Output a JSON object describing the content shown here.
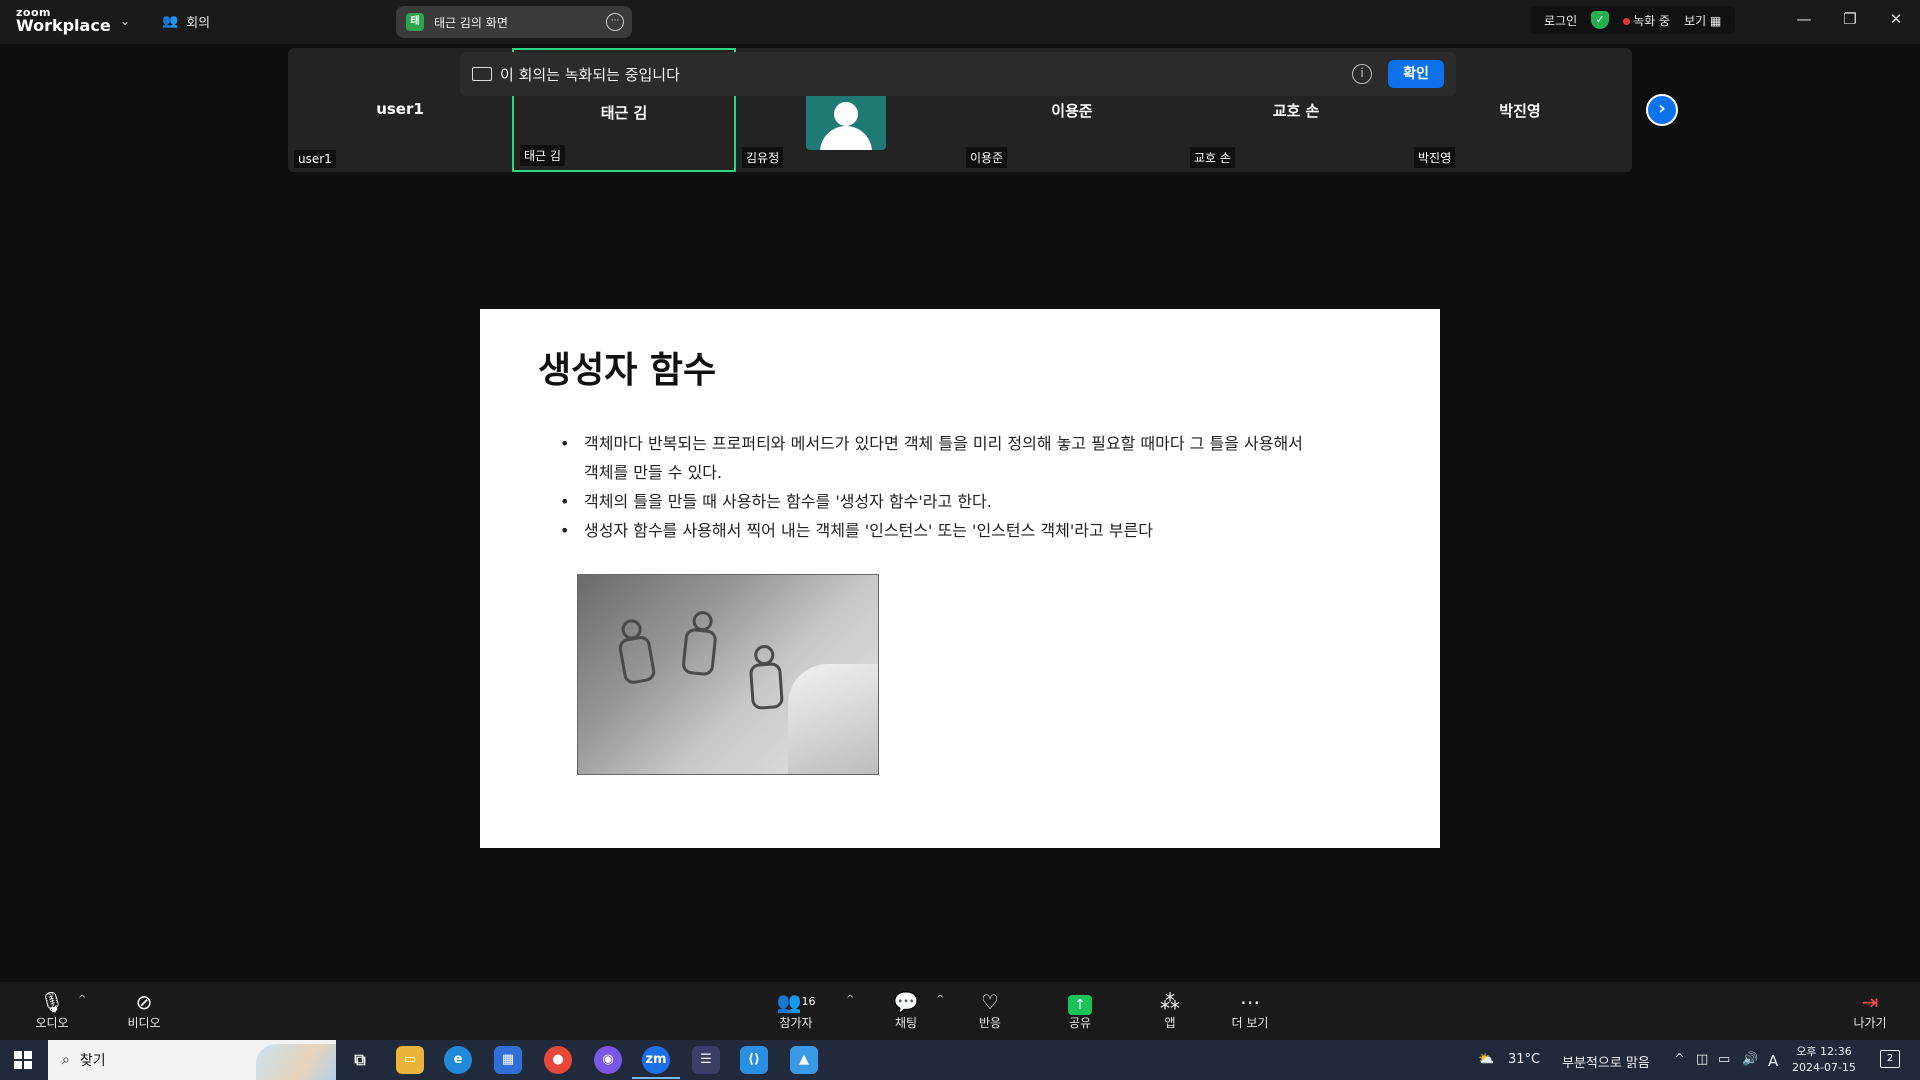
{
  "app": {
    "logo_top": "zoom",
    "logo_bottom": "Workplace",
    "meeting_label": "회의"
  },
  "share": {
    "tag": "태",
    "label": "태근 김의 화면",
    "more": "···"
  },
  "header_right": {
    "login": "로그인",
    "recording": "녹화 중",
    "view": "보기"
  },
  "participants": [
    {
      "name": "user1",
      "label": "user1"
    },
    {
      "name": "태근 김",
      "label": "태근 김"
    },
    {
      "name": "",
      "label": "김유정"
    },
    {
      "name": "이용준",
      "label": "이용준"
    },
    {
      "name": "교호 손",
      "label": "교호 손"
    },
    {
      "name": "박진영",
      "label": "박진영"
    }
  ],
  "banner": {
    "text": "이 회의는 녹화되는 중입니다",
    "info": "i",
    "confirm": "확인"
  },
  "slide": {
    "title": "생성자 함수",
    "bullets": [
      "객체마다 반복되는 프로퍼티와 메서드가 있다면 객체 틀을 미리 정의해 놓고 필요할 때마다 그 틀을 사용해서 객체를 만들 수 있다.",
      "객체의 틀을 만들 때 사용하는 함수를 '생성자 함수'라고 한다.",
      "생성자 함수를 사용해서 찍어 내는 객체를 '인스턴스' 또는 '인스턴스 객체'라고 부른다"
    ]
  },
  "toolbar": {
    "audio": "오디오",
    "video": "비디오",
    "participants": "참가자",
    "participant_count": "16",
    "chat": "채팅",
    "reactions": "반응",
    "share": "공유",
    "apps": "앱",
    "more": "더 보기",
    "leave": "나가기"
  },
  "taskbar": {
    "search": "찾기",
    "weather_temp": "31°C",
    "weather_text": "부분적으로 맑음",
    "ime": "A",
    "time": "오후 12:36",
    "date": "2024-07-15",
    "notifications": "2",
    "zoom_icon": "zm"
  },
  "colors": {
    "accent": "#0e72ed",
    "active_tile": "#2fd282",
    "share_green": "#19c35a",
    "rec_red": "#e5353b"
  }
}
